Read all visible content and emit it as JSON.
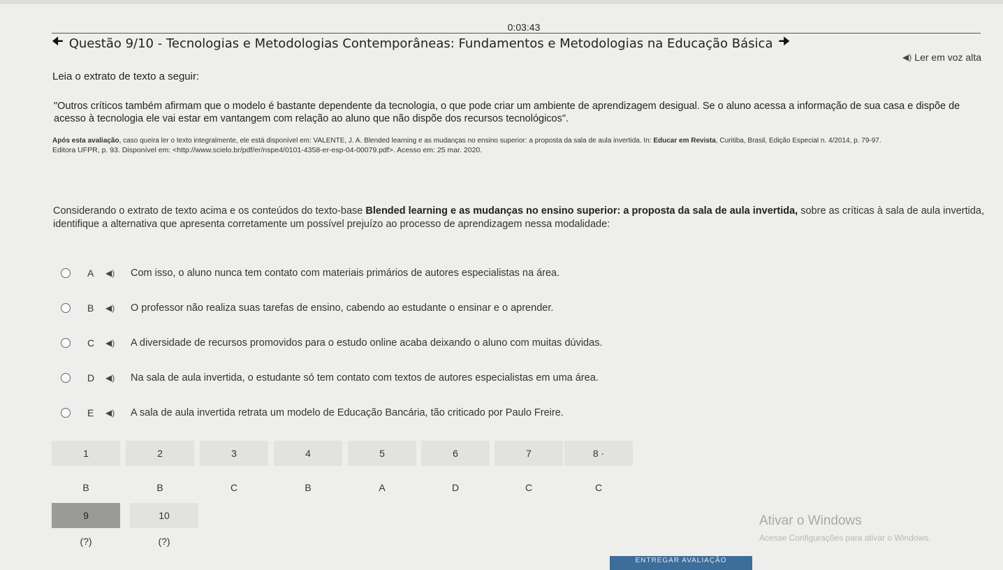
{
  "timer": "0:03:43",
  "question": {
    "title": "Questão 9/10 - Tecnologias e Metodologias Contemporâneas: Fundamentos e Metodologias na Educação Básica",
    "tts_label": "Ler em voz alta",
    "intro": "Leia o extrato de texto a seguir:",
    "quote_line1": "\"Outros críticos também afirmam que o modelo é bastante dependente da tecnologia, o que pode criar um ambiente de aprendizagem desigual. Se o aluno acessa a informação de sua casa e dispõe de",
    "quote_line2": "acesso à tecnologia ele vai estar em vantangem com relação ao aluno que não dispõe dos recursos tecnológicos\".",
    "ref_bold1": "Após esta avaliação",
    "ref_text1": ", caso queira ler o texto integralmente, ele está disponível em: VALENTE, J. A. Blended learning e as mudanças no ensino superior: a proposta da sala de aula invertida. In: ",
    "ref_bold2": "Educar em Revista",
    "ref_text2": ", Curitiba, Brasil, Edição Especial n. 4/2014, p. 79-97.",
    "ref_line2": "Editora UFPR, p. 93. Disponível em: <http://www.scielo.br/pdf/er/nspe4/0101-4358-er-esp-04-00079.pdf>. Acesso em: 25 mar. 2020.",
    "consider_pre": "Considerando o extrato de texto acima e os conteúdos do texto-base ",
    "consider_bold": "Blended learning e as mudanças no ensino superior: a proposta da sala de aula invertida,",
    "consider_post": " sobre as críticas à sala de aula invertida, identifique a alternativa que apresenta corretamente um possível prejuízo ao processo de aprendizagem nessa modalidade:"
  },
  "options": [
    {
      "letter": "A",
      "text": "Com isso, o aluno nunca tem contato com materiais primários de autores especialistas na área."
    },
    {
      "letter": "B",
      "text": "O professor não realiza suas tarefas de ensino, cabendo ao estudante o ensinar e o aprender."
    },
    {
      "letter": "C",
      "text": "A diversidade de recursos promovidos para o estudo online acaba deixando o aluno com muitas dúvidas."
    },
    {
      "letter": "D",
      "text": "Na sala de aula invertida, o estudante só tem contato com textos de autores especialistas em uma área."
    },
    {
      "letter": "E",
      "text": "A sala de aula invertida retrata um modelo de Educação Bancária, tão criticado por Paulo Freire."
    }
  ],
  "nav": [
    {
      "num": "1",
      "answer": "B"
    },
    {
      "num": "2",
      "answer": "B"
    },
    {
      "num": "3",
      "answer": "C"
    },
    {
      "num": "4",
      "answer": "B"
    },
    {
      "num": "5",
      "answer": "A"
    },
    {
      "num": "6",
      "answer": "D"
    },
    {
      "num": "7",
      "answer": "C"
    },
    {
      "num": "8 ·",
      "answer": "C"
    },
    {
      "num": "9",
      "answer": "(?)"
    },
    {
      "num": "10",
      "answer": "(?)"
    }
  ],
  "watermark": {
    "title": "Ativar o Windows",
    "subtitle": "Acesse Configurações para ativar o Windows."
  },
  "submit_label": "ENTREGAR AVALIAÇÃO",
  "colors": {
    "active_cell": "#9a9a98",
    "submit": "#3d6d99"
  }
}
